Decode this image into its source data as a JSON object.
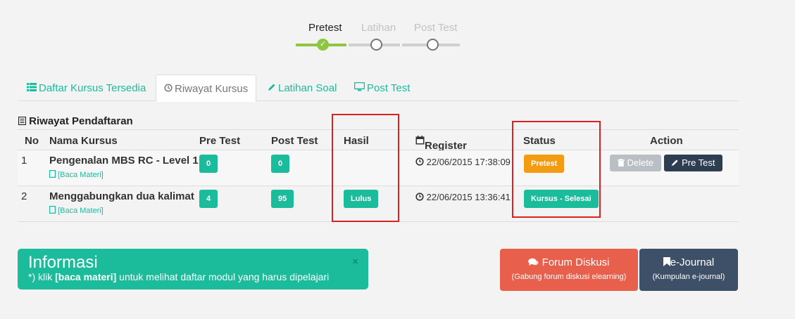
{
  "stepper": {
    "steps": [
      {
        "label": "Pretest",
        "state": "done"
      },
      {
        "label": "Latihan",
        "state": "pending"
      },
      {
        "label": "Post Test",
        "state": "pending"
      }
    ],
    "check_glyph": "✓"
  },
  "tabs": [
    {
      "label": "Daftar Kursus Tersedia",
      "icon": "list-icon",
      "active": false
    },
    {
      "label": "Riwayat Kursus",
      "icon": "history-icon",
      "active": true
    },
    {
      "label": "Latihan Soal",
      "icon": "pencil-icon",
      "active": false
    },
    {
      "label": "Post Test",
      "icon": "monitor-icon",
      "active": false
    }
  ],
  "section": {
    "title": "Riwayat Pendaftaran",
    "icon": "list-alt-icon"
  },
  "table": {
    "headers": {
      "no": "No",
      "nama": "Nama Kursus",
      "pretest": "Pre Test",
      "posttest": "Post Test",
      "hasil": "Hasil",
      "register": "Register",
      "status": "Status",
      "action": "Action"
    },
    "rows": [
      {
        "no": "1",
        "nama": "Pengenalan MBS RC - Level 1",
        "baca": "[Baca Materi]",
        "pretest": "0",
        "posttest": "0",
        "hasil": "",
        "register": "22/06/2015 17:38:09",
        "status": "Pretest",
        "actions": {
          "delete": "Delete",
          "pretest": "Pre Test"
        }
      },
      {
        "no": "2",
        "nama": "Menggabungkan dua kalimat",
        "baca": "[Baca Materi]",
        "pretest": "4",
        "posttest": "95",
        "hasil": "Lulus",
        "register": "22/06/2015 13:36:41",
        "status": "Kursus - Selesai"
      }
    ]
  },
  "info": {
    "title": "Informasi",
    "text_prefix": "*) klik ",
    "text_bold": "[baca materi]",
    "text_suffix": " untuk melihat daftar modul yang harus dipelajari",
    "close": "×"
  },
  "cards": {
    "forum": {
      "label": "Forum Diskusi",
      "sub": "(Gabung forum diskusi elearning)",
      "color": "#e8604c"
    },
    "journal": {
      "label": "e-Journal",
      "sub": "(Kumpulan e-journal)",
      "color": "#3d5068"
    }
  },
  "colors": {
    "accent": "#1abc9c",
    "step_done": "#8dc63f",
    "warning": "#f39c12",
    "highlight": "#e02020"
  }
}
